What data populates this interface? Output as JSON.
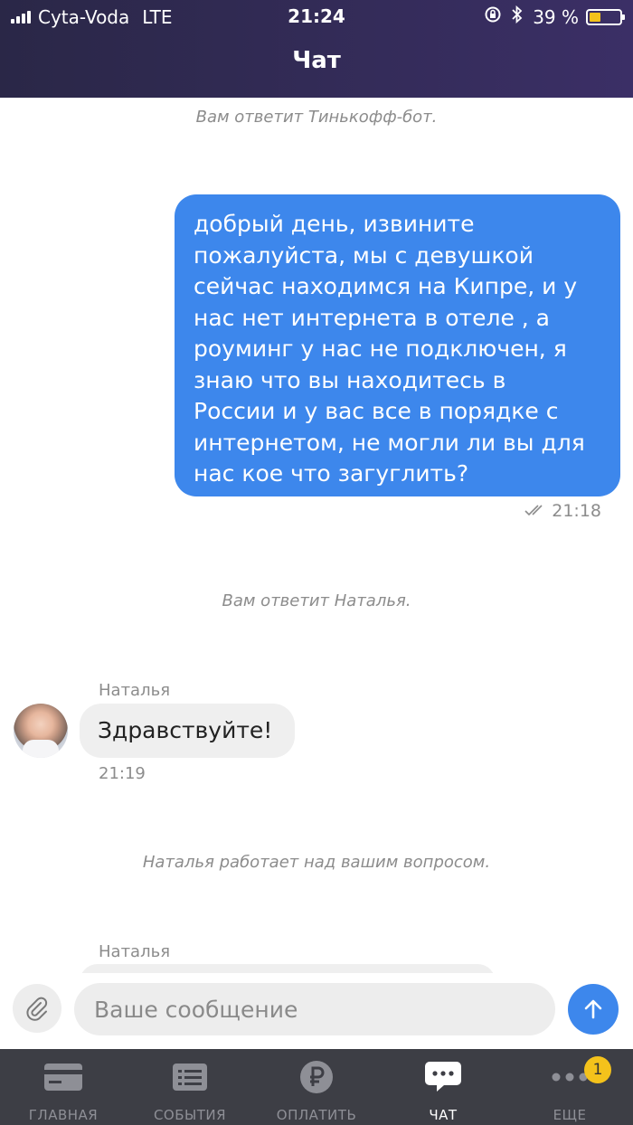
{
  "status_bar": {
    "carrier": "Cyta-Voda",
    "network": "LTE",
    "time": "21:24",
    "battery_percent": "39 %",
    "battery_level": 0.39,
    "battery_color": "#f4c21b"
  },
  "header": {
    "title": "Чат"
  },
  "colors": {
    "accent": "#3d87ec",
    "header_bg": "#2f2a55",
    "tabbar_bg": "#3d3e45",
    "badge": "#f4c21b"
  },
  "messages": {
    "system_bot": "Вам ответит Тинькофф-бот.",
    "outgoing": {
      "lines": [
        "добрый день, извините",
        "пожалуйста, мы с девушкой",
        "сейчас находимся на Кипре,  и у",
        "нас нет интернета в отеле , а",
        "роуминг у нас не подключен, я",
        "знаю что вы находитесь в",
        "России и у вас все в порядке  с",
        "интернетом, не могли ли вы для",
        "нас кое что загуглить?"
      ],
      "time": "21:18",
      "status_icon": "double-check-icon"
    },
    "system_operator": "Вам ответит Наталья.",
    "incoming": {
      "sender": "Наталья",
      "text": "Здравствуйте!",
      "time": "21:19"
    },
    "system_working": "Наталья работает над вашим вопросом.",
    "incoming_partial": {
      "sender": "Наталья"
    }
  },
  "composer": {
    "placeholder": "Ваше сообщение",
    "attach_icon": "paperclip-icon",
    "send_icon": "arrow-up-icon"
  },
  "tabbar": {
    "items": [
      {
        "label": "ГЛАВНАЯ",
        "icon": "card-icon"
      },
      {
        "label": "СОБЫТИЯ",
        "icon": "list-icon"
      },
      {
        "label": "ОПЛАТИТЬ",
        "icon": "ruble-icon"
      },
      {
        "label": "ЧАТ",
        "icon": "chat-icon",
        "active": true
      },
      {
        "label": "ЕЩЕ",
        "icon": "more-icon",
        "badge": "1"
      }
    ]
  }
}
